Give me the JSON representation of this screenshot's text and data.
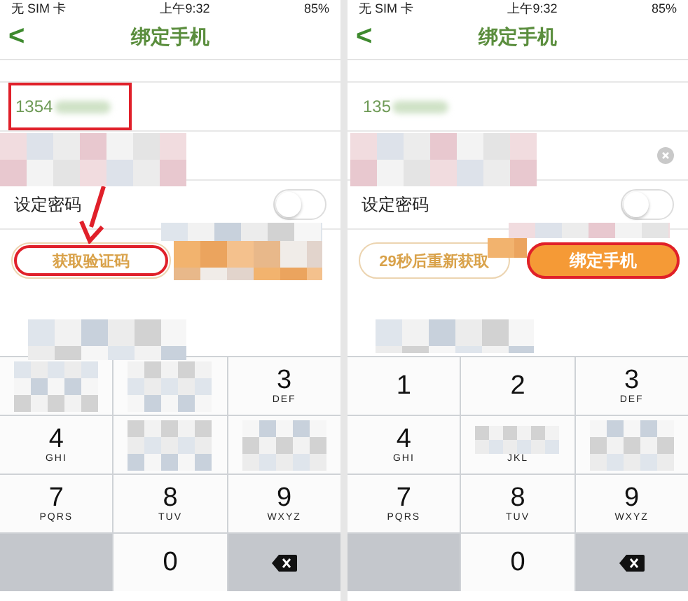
{
  "screens": [
    {
      "status_bar": {
        "carrier": "无 SIM 卡",
        "time": "上午9:32",
        "battery": "85%"
      },
      "nav": {
        "back": "<",
        "title": "绑定手机"
      },
      "phone_field": {
        "value": "1354",
        "annotated": true
      },
      "password_toggle": {
        "label": "设定密码",
        "on": false
      },
      "code_button": {
        "label": "获取验证码",
        "annotated": true
      },
      "arrow": true,
      "keypad": [
        [
          {
            "kind": "key"
          },
          {
            "kind": "key"
          },
          {
            "kind": "key",
            "digit": "3",
            "letters": "DEF"
          }
        ],
        [
          {
            "kind": "key",
            "digit": "4",
            "letters": "GHI"
          },
          {
            "kind": "key"
          },
          {
            "kind": "key"
          }
        ],
        [
          {
            "kind": "key",
            "digit": "7",
            "letters": "PQRS"
          },
          {
            "kind": "key",
            "digit": "8",
            "letters": "TUV"
          },
          {
            "kind": "key",
            "digit": "9",
            "letters": "WXYZ"
          }
        ],
        [
          {
            "kind": "blank"
          },
          {
            "kind": "key",
            "digit": "0"
          },
          {
            "kind": "delete"
          }
        ]
      ]
    },
    {
      "status_bar": {
        "carrier": "无 SIM 卡",
        "time": "上午9:32",
        "battery": "85%"
      },
      "nav": {
        "back": "<",
        "title": "绑定手机"
      },
      "phone_field": {
        "value": "135",
        "annotated": false
      },
      "clear_button": true,
      "password_toggle": {
        "label": "设定密码",
        "on": false
      },
      "code_button": {
        "label": "29秒后重新获取",
        "annotated": false
      },
      "bind_button": {
        "label": "绑定手机",
        "annotated": true
      },
      "keypad": [
        [
          {
            "kind": "key",
            "digit": "1"
          },
          {
            "kind": "key",
            "digit": "2"
          },
          {
            "kind": "key",
            "digit": "3",
            "letters": "DEF"
          }
        ],
        [
          {
            "kind": "key",
            "digit": "4",
            "letters": "GHI"
          },
          {
            "kind": "key",
            "letters": "JKL"
          },
          {
            "kind": "key"
          }
        ],
        [
          {
            "kind": "key",
            "digit": "7",
            "letters": "PQRS"
          },
          {
            "kind": "key",
            "digit": "8",
            "letters": "TUV"
          },
          {
            "kind": "key",
            "digit": "9",
            "letters": "WXYZ"
          }
        ],
        [
          {
            "kind": "blank"
          },
          {
            "kind": "key",
            "digit": "0"
          },
          {
            "kind": "delete"
          }
        ]
      ]
    }
  ]
}
